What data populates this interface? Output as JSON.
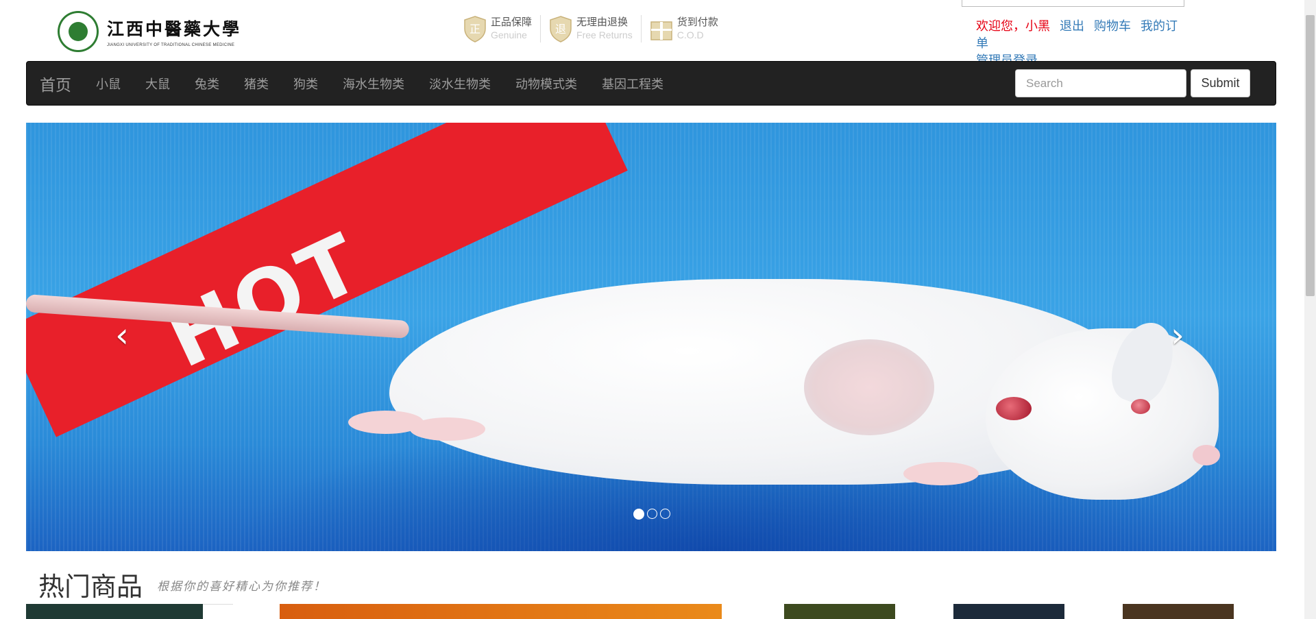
{
  "header": {
    "logo_cn": "江西中醫藥大學",
    "logo_en": "JIANGXI UNIVERSITY OF TRADITIONAL CHINESE MEDICINE",
    "guarantees": [
      {
        "title": "正品保障",
        "sub": "Genuine",
        "icon": "shield-zheng-icon"
      },
      {
        "title": "无理由退换",
        "sub": "Free Returns",
        "icon": "shield-return-icon"
      },
      {
        "title": "货到付款",
        "sub": "C.O.D",
        "icon": "gift-box-icon"
      }
    ],
    "user": {
      "welcome": "欢迎您，小黑",
      "logout": "退出",
      "cart": "购物车",
      "orders": "我的订单",
      "admin_login": "管理员登录"
    }
  },
  "navbar": {
    "brand": "首页",
    "items": [
      "小鼠",
      "大鼠",
      "兔类",
      "猪类",
      "狗类",
      "海水生物类",
      "淡水生物类",
      "动物模式类",
      "基因工程类"
    ],
    "search_placeholder": "Search",
    "submit_label": "Submit"
  },
  "carousel": {
    "banner_text": "HOT",
    "prev_glyph": "‹",
    "next_glyph": "›",
    "slide_count": 3,
    "active_slide": 1
  },
  "hot_products": {
    "title": "热门商品",
    "subtitle": "根据你的喜好精心为你推荐！"
  },
  "colors": {
    "navbar_bg": "#222222",
    "nav_text": "#9d9d9d",
    "welcome_red": "#e60012",
    "link_blue": "#337ab7",
    "hot_red": "#e8202a"
  }
}
